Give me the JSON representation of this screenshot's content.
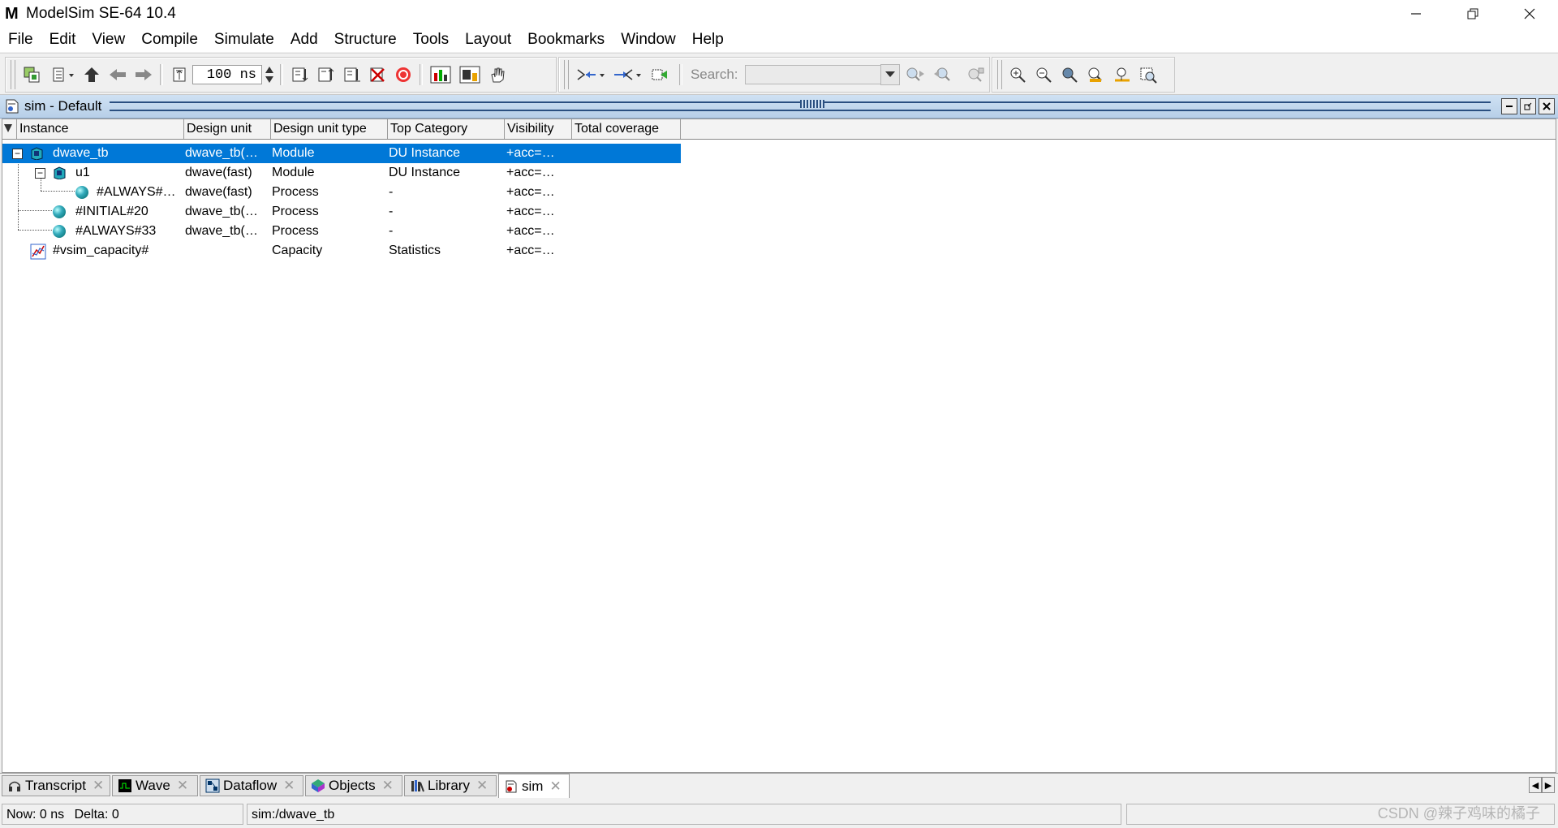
{
  "window": {
    "title": "ModelSim SE-64 10.4",
    "logo_text": "M"
  },
  "menu": [
    "File",
    "Edit",
    "View",
    "Compile",
    "Simulate",
    "Add",
    "Structure",
    "Tools",
    "Layout",
    "Bookmarks",
    "Window",
    "Help"
  ],
  "toolbar": {
    "run_length": "100 ns",
    "search_label": "Search:",
    "search_value": ""
  },
  "pane": {
    "title": "sim - Default"
  },
  "table": {
    "columns": [
      "Instance",
      "Design unit",
      "Design unit type",
      "Top Category",
      "Visibility",
      "Total coverage"
    ],
    "rows": [
      {
        "instance": "dwave_tb",
        "design_unit": "dwave_tb(…",
        "type": "Module",
        "category": "DU Instance",
        "visibility": "+acc=…",
        "coverage": ""
      },
      {
        "instance": "u1",
        "design_unit": "dwave(fast)",
        "type": "Module",
        "category": "DU Instance",
        "visibility": "+acc=…",
        "coverage": ""
      },
      {
        "instance": "#ALWAYS#…",
        "design_unit": "dwave(fast)",
        "type": "Process",
        "category": "-",
        "visibility": "+acc=…",
        "coverage": ""
      },
      {
        "instance": "#INITIAL#20",
        "design_unit": "dwave_tb(…",
        "type": "Process",
        "category": "-",
        "visibility": "+acc=…",
        "coverage": ""
      },
      {
        "instance": "#ALWAYS#33",
        "design_unit": "dwave_tb(…",
        "type": "Process",
        "category": "-",
        "visibility": "+acc=…",
        "coverage": ""
      },
      {
        "instance": "#vsim_capacity#",
        "design_unit": "",
        "type": "Capacity",
        "category": "Statistics",
        "visibility": "+acc=…",
        "coverage": ""
      }
    ]
  },
  "tabs": [
    "Transcript",
    "Wave",
    "Dataflow",
    "Objects",
    "Library",
    "sim"
  ],
  "status": {
    "now": "Now: 0 ns",
    "delta": "Delta: 0",
    "context": "sim:/dwave_tb"
  },
  "watermark": "CSDN @辣子鸡味的橘子",
  "colors": {
    "selection": "#0078d7",
    "pane_header": "#b7cfe8"
  }
}
